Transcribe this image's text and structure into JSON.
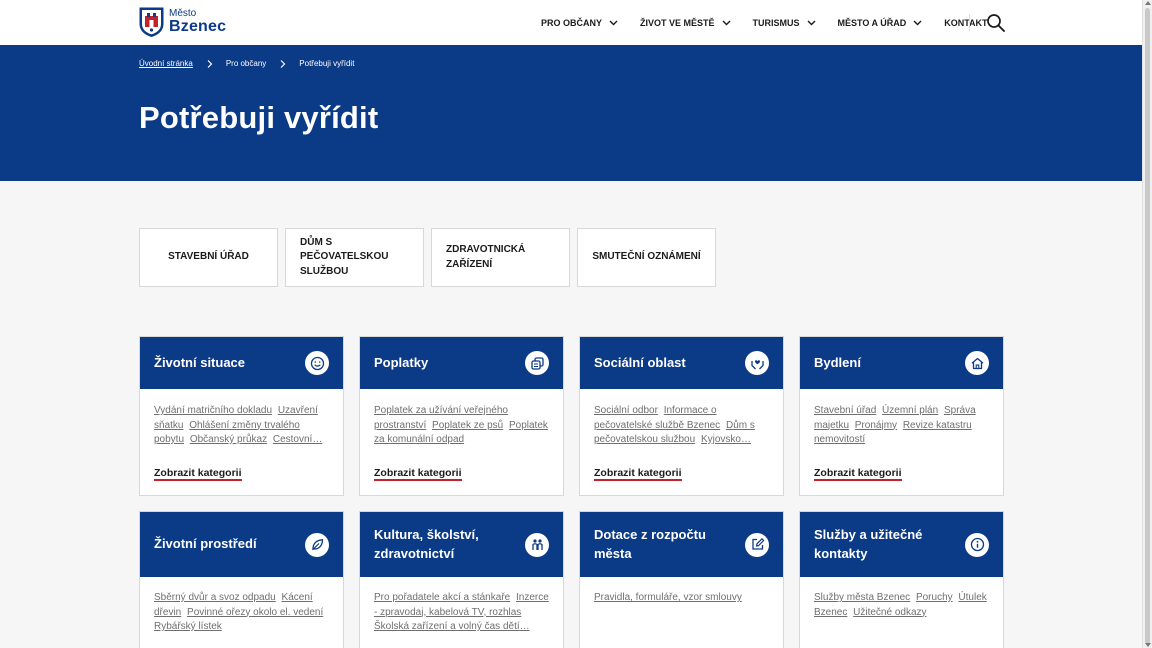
{
  "header": {
    "logo_small": "Město",
    "logo_big": "Bzenec",
    "nav": [
      {
        "label": "Pro občany",
        "has_dropdown": true
      },
      {
        "label": "Život ve městě",
        "has_dropdown": true
      },
      {
        "label": "Turismus",
        "has_dropdown": true
      },
      {
        "label": "Město a úřad",
        "has_dropdown": true
      },
      {
        "label": "Kontakt",
        "has_dropdown": false
      }
    ],
    "search_icon": "search-icon"
  },
  "breadcrumb": {
    "items": [
      "Úvodní stránka",
      "Pro občany",
      "Potřebuji vyřídit"
    ]
  },
  "page_title": "Potřebuji vyřídit",
  "quick_tiles": [
    "Stavební úřad",
    "Dům s pečovatelskou službou",
    "Zdravotnická zařízení",
    "Smuteční oznámení"
  ],
  "cards": [
    {
      "title": "Životní situace",
      "icon": "smile-icon",
      "links": [
        "Vydání matričního dokladu",
        "Uzavření sňatku",
        "Ohlášení změny trvalého pobytu",
        "Občanský průkaz",
        "Cestovní…"
      ],
      "show_all": "Zobrazit kategorii"
    },
    {
      "title": "Poplatky",
      "icon": "coins-icon",
      "links": [
        "Poplatek za užívání veřejného prostranství",
        "Poplatek ze psů",
        "Poplatek za komunální odpad"
      ],
      "show_all": "Zobrazit kategorii"
    },
    {
      "title": "Sociální oblast",
      "icon": "hands-heart-icon",
      "links": [
        "Sociální odbor",
        "Informace o pečovatelské službě Bzenec",
        "Dům s pečovatelskou službou",
        "Kyjovsko…"
      ],
      "show_all": "Zobrazit kategorii"
    },
    {
      "title": "Bydlení",
      "icon": "home-icon",
      "links": [
        "Stavební úřad",
        "Územní plán",
        "Správa majetku",
        "Pronájmy",
        "Revize katastru nemovitostí"
      ],
      "show_all": "Zobrazit kategorii"
    },
    {
      "title": "Životní prostředí",
      "icon": "leaf-icon",
      "links": [
        "Sběrný dvůr a svoz odpadu",
        "Kácení dřevin",
        "Povinné ořezy okolo el. vedení",
        "Rybářský lístek"
      ]
    },
    {
      "title": "Kultura, školství, zdravotnictví",
      "icon": "people-icon",
      "links": [
        "Pro pořadatele akcí a stánkaře",
        "Inzerce - zpravodaj, kabelová TV, rozhlas",
        "Školská zařízení a volný čas dětí…"
      ]
    },
    {
      "title": "Dotace z rozpočtu města",
      "icon": "edit-icon",
      "links": [
        "Pravidla, formuláře, vzor smlouvy"
      ]
    },
    {
      "title": "Služby a užitečné kontakty",
      "icon": "info-icon",
      "links": [
        "Služby města Bzenec",
        "Poruchy",
        "Útulek Bzenec",
        "Užitečné odkazy"
      ]
    }
  ],
  "colors": {
    "brand_blue": "#0b3a86",
    "accent_red": "#c3212c",
    "link_gray": "#6f6f6f"
  }
}
